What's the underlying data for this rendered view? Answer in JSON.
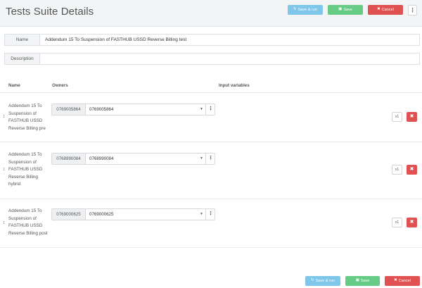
{
  "header": {
    "title": "Tests Suite Details",
    "save_run_label": "Save & run",
    "save_label": "Save",
    "cancel_label": "Cancel",
    "menu_glyph": "⋮"
  },
  "form": {
    "name_label": "Name",
    "name_value": "Addendum 15 To Suspension of FASTHUB USSD Reverse Billing test",
    "description_label": "Description",
    "description_value": ""
  },
  "table": {
    "columns": [
      "Name",
      "Owners",
      "Input variables"
    ],
    "rows": [
      {
        "name_lines": [
          "Addendum 15 To",
          "Suspension of",
          "FASTHUB USSD",
          "Reverse Billing pre"
        ],
        "owner_tag": "0769005864",
        "owner_value": "0769005864",
        "multiplier": "x1"
      },
      {
        "name_lines": [
          "Addendum 15 To",
          "Suspension of",
          "FASTHUB USSD",
          "Reverse Billing",
          "hybrid"
        ],
        "owner_tag": "0768990084",
        "owner_value": "0768990084",
        "multiplier": "x1"
      },
      {
        "name_lines": [
          "Addendum 15 To",
          "Suspension of",
          "FASTHUB USSD",
          "Reverse Billing post"
        ],
        "owner_tag": "0769000625",
        "owner_value": "0769000625",
        "multiplier": "x1"
      }
    ]
  },
  "footer": {
    "save_run_label": "Save & run",
    "save_label": "Save",
    "cancel_label": "Cancel"
  },
  "icons": {
    "save_run": "↻",
    "save": "▣",
    "cancel": "✖",
    "delete": "✖",
    "drag": "↕",
    "caret": "▼",
    "dots": "⋮"
  },
  "colors": {
    "save_run": "#7fc7ea",
    "save": "#66cc85",
    "cancel": "#e05252"
  }
}
